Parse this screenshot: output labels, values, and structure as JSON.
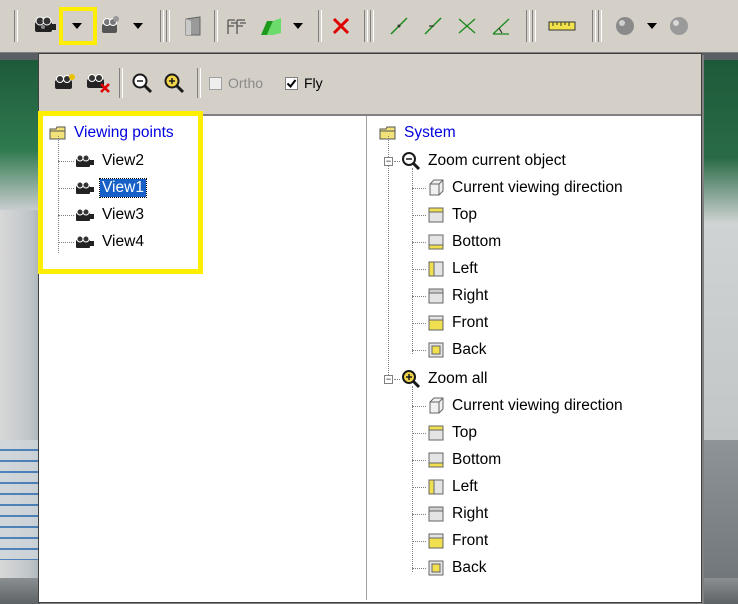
{
  "window": {
    "title": "Viewing points"
  },
  "popup": {
    "ortho_label": "Ortho",
    "fly_label": "Fly",
    "ortho_checked": false,
    "fly_checked": true
  },
  "left_tree": {
    "root": "Viewing points",
    "items": [
      "View2",
      "View1",
      "View3",
      "View4"
    ],
    "selected": "View1"
  },
  "right_tree": {
    "root": "System",
    "groups": [
      {
        "label": "Zoom current object",
        "items": [
          "Current viewing direction",
          "Top",
          "Bottom",
          "Left",
          "Right",
          "Front",
          "Back"
        ]
      },
      {
        "label": "Zoom all",
        "items": [
          "Current viewing direction",
          "Top",
          "Bottom",
          "Left",
          "Right",
          "Front",
          "Back"
        ]
      }
    ]
  },
  "icons": {
    "toolbar": [
      "camera-icon",
      "dropdown-arrow-icon",
      "camera-settings-icon",
      "dropdown-arrow-icon",
      "door-icon",
      "level-icon",
      "wall-icon",
      "dropdown-arrow-icon",
      "delete-icon",
      "line-icon",
      "line-icon",
      "cross-icon",
      "angle-icon",
      "ruler-icon",
      "sphere-icon",
      "dropdown-arrow-icon"
    ],
    "popup": [
      "add-camera-icon",
      "delete-camera-icon",
      "zoom-icon",
      "zoom-all-icon"
    ]
  },
  "colors": {
    "highlight": "#ffee00",
    "selection": "#1660c8",
    "link_text": "#0000e0",
    "toolbar_bg": "#d4d0c8"
  }
}
